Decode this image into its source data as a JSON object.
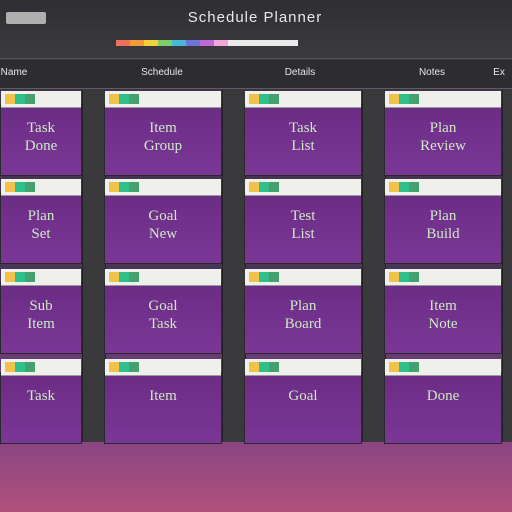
{
  "app": {
    "window_title": "Schedule Planner",
    "color_strip": [
      "#f06f5a",
      "#f29a3c",
      "#f3d13c",
      "#7ccf6a",
      "#45b8d8",
      "#6c74d6",
      "#c16ad7",
      "#f0a6d8",
      "#eaeaea"
    ]
  },
  "header": {
    "columns": [
      "Name",
      "Schedule",
      "Details",
      "Notes",
      "Ex"
    ]
  },
  "grid": {
    "rows": [
      {
        "cells": [
          "Task\nDone",
          "Item\nGroup",
          "Task\nList",
          "Plan\nReview"
        ]
      },
      {
        "cells": [
          "Plan\nSet",
          "Goal\nNew",
          "Test\nList",
          "Plan\nBuild"
        ]
      },
      {
        "cells": [
          "Sub\nItem",
          "Goal\nTask",
          "Plan\nBoard",
          "Item\nNote"
        ]
      },
      {
        "cells": [
          "Task",
          "Item",
          "Goal",
          "Done"
        ]
      }
    ]
  },
  "colors": {
    "cell_purple": "#6b2c85",
    "accent_green": "#2fbf8a",
    "accent_yellow": "#f2c14a"
  }
}
